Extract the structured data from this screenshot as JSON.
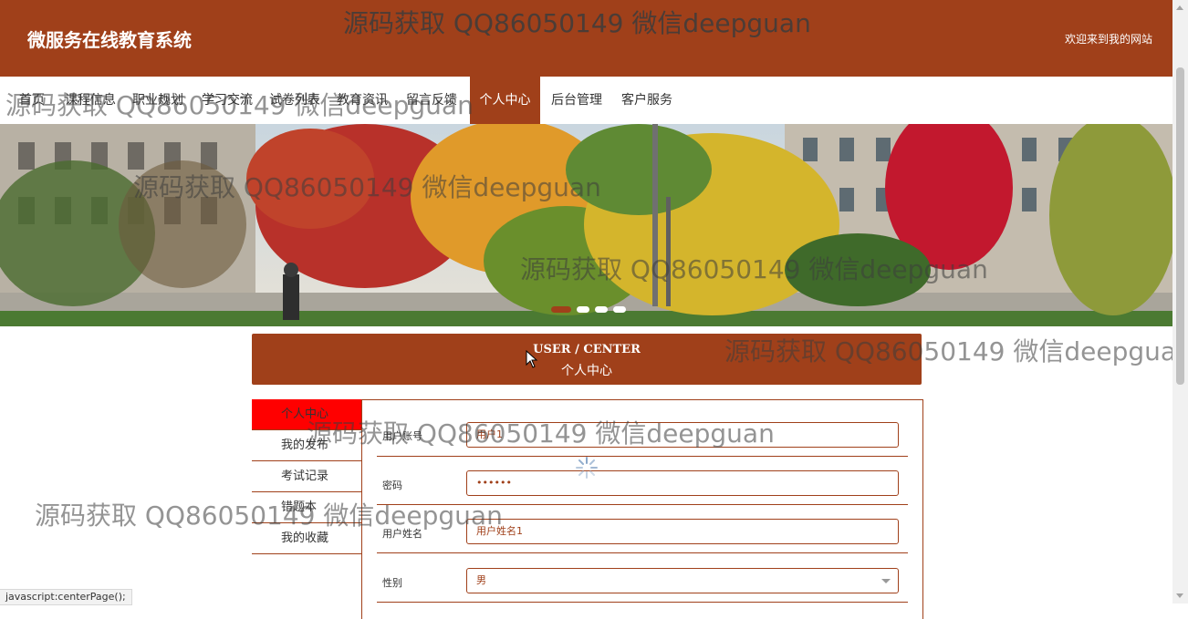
{
  "header": {
    "site_title": "微服务在线教育系统",
    "welcome": "欢迎来到我的网站"
  },
  "nav": {
    "items": [
      {
        "label": "首页"
      },
      {
        "label": "课程信息"
      },
      {
        "label": "职业规划"
      },
      {
        "label": "学习交流"
      },
      {
        "label": "试卷列表"
      },
      {
        "label": "教育资讯"
      },
      {
        "label": "留言反馈"
      },
      {
        "label": "个人中心",
        "active": true
      },
      {
        "label": "后台管理"
      },
      {
        "label": "客户服务"
      }
    ]
  },
  "section": {
    "title_en": "USER / CENTER",
    "title_cn": "个人中心"
  },
  "sidebar": {
    "items": [
      {
        "label": "个人中心",
        "active": true
      },
      {
        "label": "我的发布"
      },
      {
        "label": "考试记录"
      },
      {
        "label": "错题本"
      },
      {
        "label": "我的收藏"
      }
    ]
  },
  "form": {
    "fields": [
      {
        "label": "用户账号",
        "value": "用户1"
      },
      {
        "label": "密码",
        "value": "••••••"
      },
      {
        "label": "用户姓名",
        "value": "用户姓名1"
      },
      {
        "label": "性别",
        "value": "男"
      }
    ]
  },
  "watermarks": [
    "源码获取 QQ86050149 微信deepguan",
    "源码获取 QQ86050149 微信deepguan",
    "源码获取 QQ86050149 微信deepguan",
    "源码获取 QQ86050149 微信deepguan",
    "源码获取 QQ86050149 微信deepguan",
    "源码获取 QQ86050149 微信deepguan",
    "源码获取 QQ86050149 微信deepguan"
  ],
  "status_bar": {
    "text": "javascript:centerPage();"
  },
  "colors": {
    "primary": "#a0401a",
    "active_sidebar": "#ff0000"
  }
}
